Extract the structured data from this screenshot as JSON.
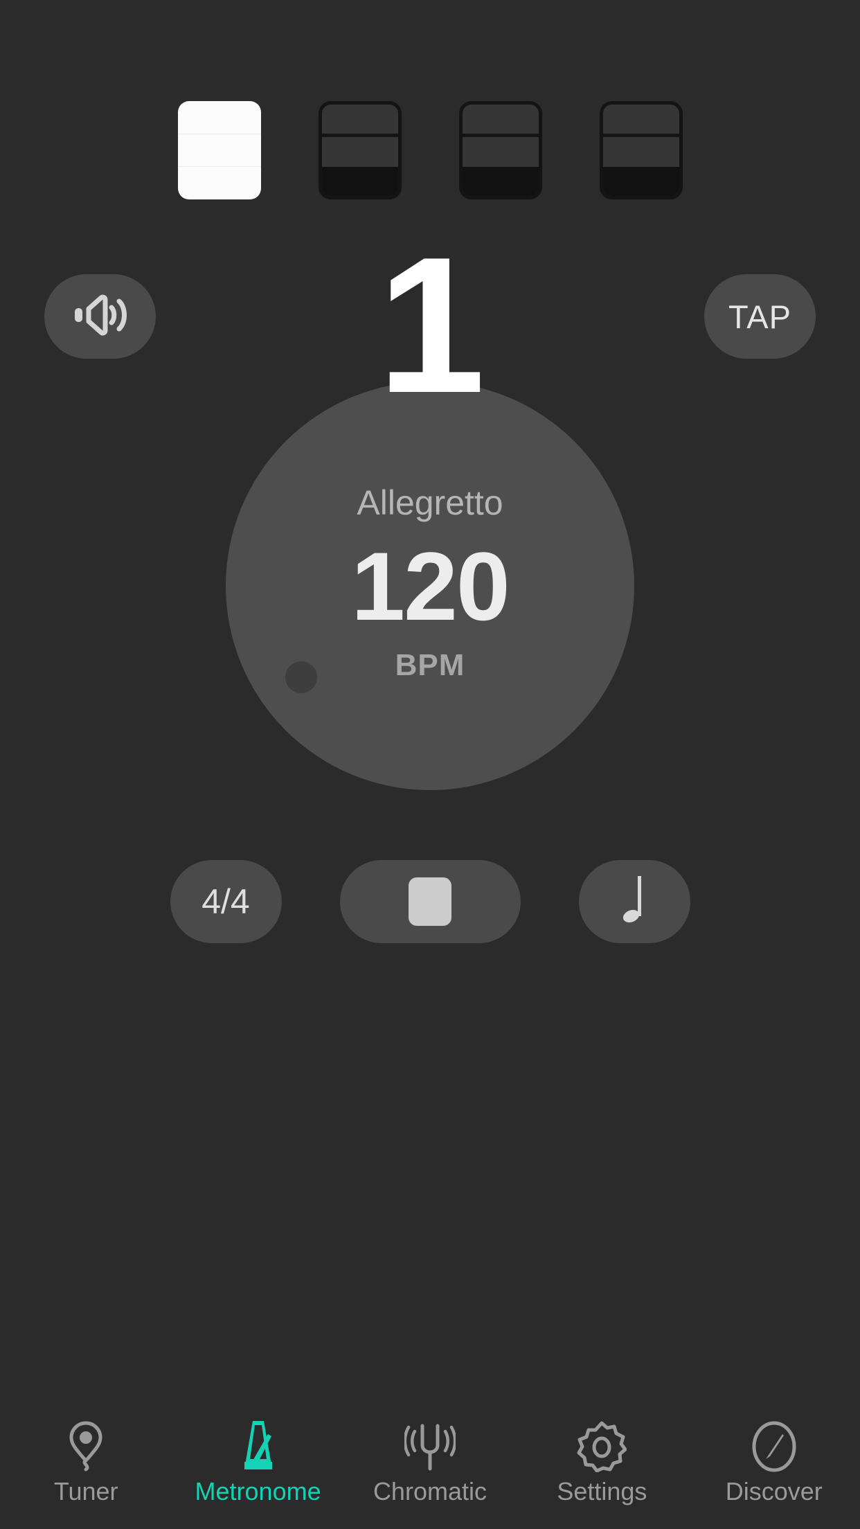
{
  "app": {
    "background_color": "#2b2b2b",
    "accent_color": "#14d3b5"
  },
  "beat_indicators": {
    "total": 4,
    "current_beat": 1,
    "items": [
      {
        "index": 1,
        "state": "active"
      },
      {
        "index": 2,
        "state": "idle"
      },
      {
        "index": 3,
        "state": "idle"
      },
      {
        "index": 4,
        "state": "idle"
      }
    ]
  },
  "beat_counter": {
    "value": "1"
  },
  "volume_button": {
    "icon": "speaker-volume-icon"
  },
  "tap_button": {
    "label": "TAP"
  },
  "dial": {
    "tempo_name": "Allegretto",
    "bpm_value": "120",
    "bpm_label": "BPM",
    "handle": "dial-handle-dot"
  },
  "controls": {
    "time_signature": {
      "label": "4/4"
    },
    "transport": {
      "icon": "stop-icon",
      "state": "playing"
    },
    "note_value": {
      "icon": "quarter-note-icon"
    }
  },
  "navbar": {
    "items": [
      {
        "label": "Tuner",
        "icon": "tuner-pin-icon",
        "active": false
      },
      {
        "label": "Metronome",
        "icon": "metronome-icon",
        "active": true
      },
      {
        "label": "Chromatic",
        "icon": "tuning-fork-icon",
        "active": false
      },
      {
        "label": "Settings",
        "icon": "gear-icon",
        "active": false
      },
      {
        "label": "Discover",
        "icon": "compass-icon",
        "active": false
      }
    ]
  }
}
